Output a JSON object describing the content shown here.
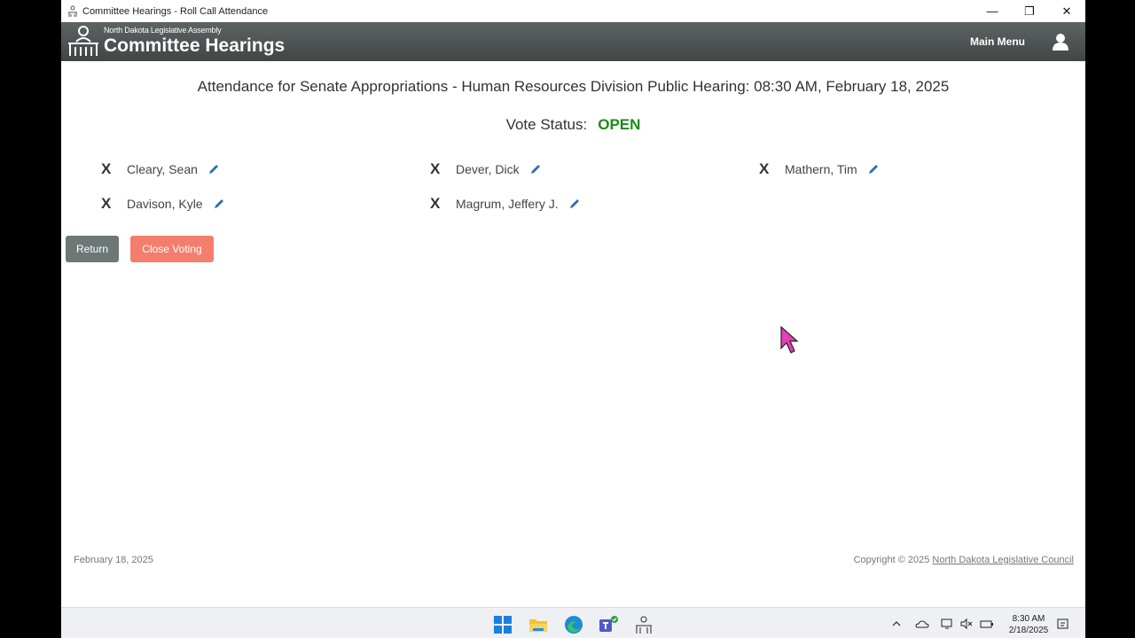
{
  "window": {
    "title": "Committee Hearings - Roll Call Attendance",
    "minimize": "—",
    "restore": "❐",
    "close": "✕"
  },
  "header": {
    "org": "North Dakota Legislative Assembly",
    "app_name": "Committee Hearings",
    "main_menu": "Main Menu"
  },
  "hearing": {
    "title": "Attendance for Senate Appropriations - Human Resources Division Public Hearing: 08:30 AM, February 18, 2025",
    "status_label": "Vote Status:",
    "status_value": "OPEN"
  },
  "members": [
    {
      "mark": "X",
      "name": "Cleary, Sean"
    },
    {
      "mark": "X",
      "name": "Dever, Dick"
    },
    {
      "mark": "X",
      "name": "Mathern, Tim"
    },
    {
      "mark": "X",
      "name": "Davison, Kyle"
    },
    {
      "mark": "X",
      "name": "Magrum, Jeffery J."
    }
  ],
  "buttons": {
    "return": "Return",
    "close_voting": "Close Voting"
  },
  "footer": {
    "date": "February 18, 2025",
    "copyright_prefix": "Copyright © 2025",
    "council_link": "North Dakota Legislative Council"
  },
  "taskbar": {
    "time": "8:30 AM",
    "date": "2/18/2025"
  },
  "colors": {
    "status_open": "#1c8a1c",
    "close_voting": "#f47e6d",
    "return": "#6c7776",
    "header": "#4f5655"
  }
}
